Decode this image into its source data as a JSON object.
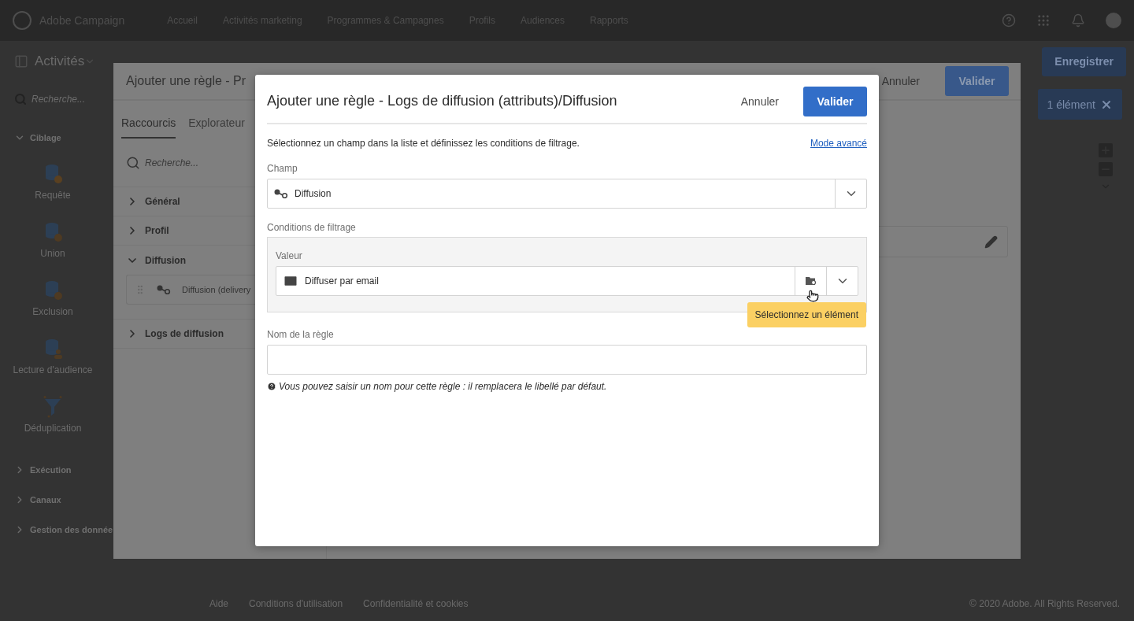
{
  "header": {
    "brand": "Adobe Campaign",
    "nav": [
      {
        "label": "Accueil"
      },
      {
        "label": "Activités marketing"
      },
      {
        "label": "Programmes & Campagnes"
      },
      {
        "label": "Profils"
      },
      {
        "label": "Audiences"
      },
      {
        "label": "Rapports"
      }
    ]
  },
  "toolbar": {
    "title": "Activités",
    "save": "Enregistrer",
    "selection_chip": "1 élément"
  },
  "sidebar": {
    "search_placeholder": "Recherche...",
    "groups": [
      {
        "label": "Ciblage",
        "expanded": true,
        "children": [
          {
            "label": "Requête",
            "kind": "query"
          },
          {
            "label": "Union",
            "kind": "union"
          },
          {
            "label": "Exclusion",
            "kind": "exclusion"
          },
          {
            "label": "Lecture d'audience",
            "kind": "audience"
          },
          {
            "label": "Déduplication",
            "kind": "dedup"
          }
        ]
      },
      {
        "label": "Exécution",
        "expanded": false
      },
      {
        "label": "Canaux",
        "expanded": false
      },
      {
        "label": "Gestion des donnée",
        "expanded": false
      }
    ]
  },
  "footer": {
    "links": [
      {
        "label": "Aide"
      },
      {
        "label": "Conditions d'utilisation"
      },
      {
        "label": "Confidentialité et cookies"
      }
    ],
    "copyright": "© 2020 Adobe. All Rights Reserved."
  },
  "rule_dialog_back": {
    "title": "Ajouter une règle - Pr",
    "cancel": "Annuler",
    "validate": "Valider",
    "tabs": [
      {
        "label": "Raccourcis",
        "selected": true
      },
      {
        "label": "Explorateur",
        "selected": false
      }
    ],
    "search_placeholder": "Recherche...",
    "tree": [
      {
        "label": "Général",
        "expanded": false
      },
      {
        "label": "Profil",
        "expanded": false
      },
      {
        "label": "Diffusion",
        "expanded": true,
        "children": [
          {
            "label": "Diffusion (delivery"
          }
        ]
      },
      {
        "label": "Logs de diffusion",
        "expanded": false
      }
    ]
  },
  "rule_dialog": {
    "title": "Ajouter une règle - Logs de diffusion (attributs)/Diffusion",
    "cancel": "Annuler",
    "validate": "Valider",
    "instructions": "Sélectionnez un champ dans la liste et définissez les conditions de filtrage.",
    "advanced_link": "Mode avancé",
    "field": {
      "label": "Champ",
      "value": "Diffusion"
    },
    "conditions": {
      "label": "Conditions de filtrage",
      "value_label": "Valeur",
      "value": "Diffuser par email",
      "tooltip": "Sélectionnez un élément"
    },
    "rule_name": {
      "label": "Nom de la règle"
    },
    "hint": "Vous pouvez saisir un nom pour cette règle : il remplacera le libellé par défaut."
  }
}
